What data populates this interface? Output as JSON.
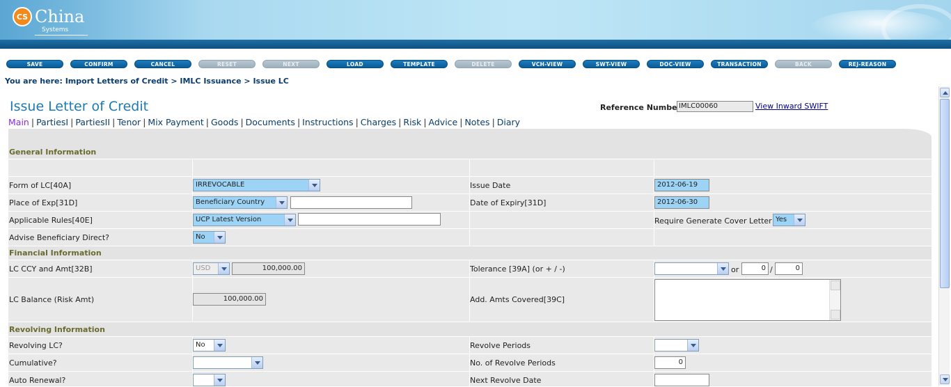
{
  "header": {
    "logo_badge": "CS",
    "logo_name": "China",
    "logo_sub": "Systems"
  },
  "toolbar": [
    {
      "label": "SAVE",
      "enabled": true
    },
    {
      "label": "CONFIRM",
      "enabled": true
    },
    {
      "label": "CANCEL",
      "enabled": true
    },
    {
      "label": "RESET",
      "enabled": false
    },
    {
      "label": "NEXT",
      "enabled": false
    },
    {
      "label": "LOAD",
      "enabled": true
    },
    {
      "label": "TEMPLATE",
      "enabled": true
    },
    {
      "label": "DELETE",
      "enabled": false
    },
    {
      "label": "VCH-VIEW",
      "enabled": true
    },
    {
      "label": "SWT-VIEW",
      "enabled": true
    },
    {
      "label": "DOC-VIEW",
      "enabled": true
    },
    {
      "label": "TRANSACTION",
      "enabled": true
    },
    {
      "label": "BACK",
      "enabled": false
    },
    {
      "label": "REJ-REASON",
      "enabled": true
    }
  ],
  "breadcrumb": "You are here:  Import Letters of Credit > IMLC Issuance > Issue LC",
  "page": {
    "title": "Issue Letter of Credit",
    "reference_label": "Reference Number",
    "reference_value": "IMLC00060",
    "view_swift": "View Inward SWIFT"
  },
  "tabs": [
    "Main",
    "PartiesI",
    "PartiesII",
    "Tenor",
    "Mix Payment",
    "Goods",
    "Documents",
    "Instructions",
    "Charges",
    "Risk",
    "Advice",
    "Notes",
    "Diary"
  ],
  "active_tab": "Main",
  "sections": {
    "general": "General Information",
    "financial": "Financial Information",
    "revolving": "Revolving Information"
  },
  "fields": {
    "form_of_lc": {
      "label": "Form of LC[40A]",
      "value": "IRREVOCABLE"
    },
    "issue_date": {
      "label": "Issue Date",
      "value": "2012-06-19"
    },
    "place_of_exp": {
      "label": "Place of Exp[31D]",
      "value": "Beneficiary Country",
      "text": ""
    },
    "date_of_expiry": {
      "label": "Date of Expiry[31D]",
      "value": "2012-06-30"
    },
    "applicable_rules": {
      "label": "Applicable Rules[40E]",
      "value": "UCP Latest Version",
      "text": ""
    },
    "cover_letter": {
      "label": "Require Generate Cover Letter",
      "value": "Yes"
    },
    "advise_direct": {
      "label": "Advise Beneficiary Direct?",
      "value": "No"
    },
    "lc_ccy_amt": {
      "label": "LC CCY and Amt[32B]",
      "ccy": "USD",
      "amount": "100,000.00"
    },
    "tolerance": {
      "label": "Tolerance [39A] (or + / -)",
      "value": "",
      "or": "or",
      "plus": "0",
      "slash": "/",
      "minus": "0"
    },
    "lc_balance": {
      "label": "LC Balance (Risk Amt)",
      "value": "100,000.00"
    },
    "add_amts": {
      "label": "Add. Amts Covered[39C]",
      "value": ""
    },
    "revolving_lc": {
      "label": "Revolving LC?",
      "value": "No"
    },
    "revolve_periods": {
      "label": "Revolve Periods",
      "value": ""
    },
    "cumulative": {
      "label": "Cumulative?",
      "value": ""
    },
    "no_revolve_periods": {
      "label": "No. of Revolve Periods",
      "value": "0"
    },
    "auto_renewal": {
      "label": "Auto Renewal?",
      "value": ""
    },
    "next_revolve_date": {
      "label": "Next Revolve Date",
      "value": ""
    }
  }
}
